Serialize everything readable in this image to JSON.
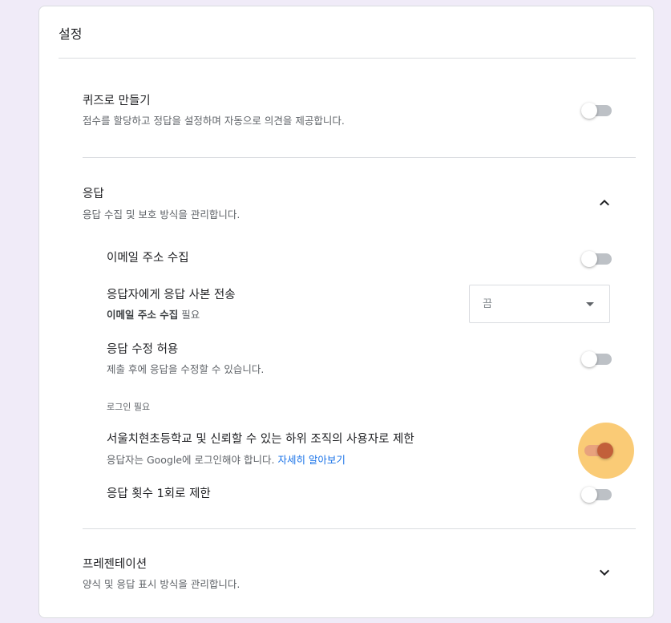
{
  "settings": {
    "title": "설정",
    "quiz": {
      "title": "퀴즈로 만들기",
      "description": "점수를 할당하고 정답을 설정하며 자동으로 의견을 제공합니다.",
      "enabled": false
    },
    "responses": {
      "title": "응답",
      "description": "응답 수집 및 보호 방식을 관리합니다.",
      "expanded": true,
      "chevron_icon": "chevron-up-icon",
      "collect_email": {
        "title": "이메일 주소 수집",
        "enabled": false
      },
      "send_copy": {
        "title": "응답자에게 응답 사본 전송",
        "requirement_bold": "이메일 주소 수집",
        "requirement_suffix": " 필요",
        "selected_value": "끔",
        "dropdown_icon": "arrow-drop-down-icon"
      },
      "allow_edit": {
        "title": "응답 수정 허용",
        "description": "제출 후에 응답을 수정할 수 있습니다.",
        "enabled": false
      },
      "login_section_label": "로그인 필요",
      "restrict_org": {
        "title": "서울치현초등학교 및 신뢰할 수 있는 하위 조직의 사용자로 제한",
        "description": "응답자는 Google에 로그인해야 합니다. ",
        "learn_more": "자세히 알아보기",
        "enabled": true
      },
      "limit_one": {
        "title": "응답 횟수 1회로 제한",
        "enabled": false
      }
    },
    "presentation": {
      "title": "프레젠테이션",
      "description": "양식 및 응답 표시 방식을 관리합니다.",
      "expanded": false,
      "chevron_icon": "chevron-down-icon"
    }
  },
  "colors": {
    "background": "#f0ebf8",
    "toggle_on_thumb": "#c2603a",
    "toggle_on_track": "#e8a27d",
    "focus_halo": "#f9c25e",
    "link": "#1a73e8"
  }
}
